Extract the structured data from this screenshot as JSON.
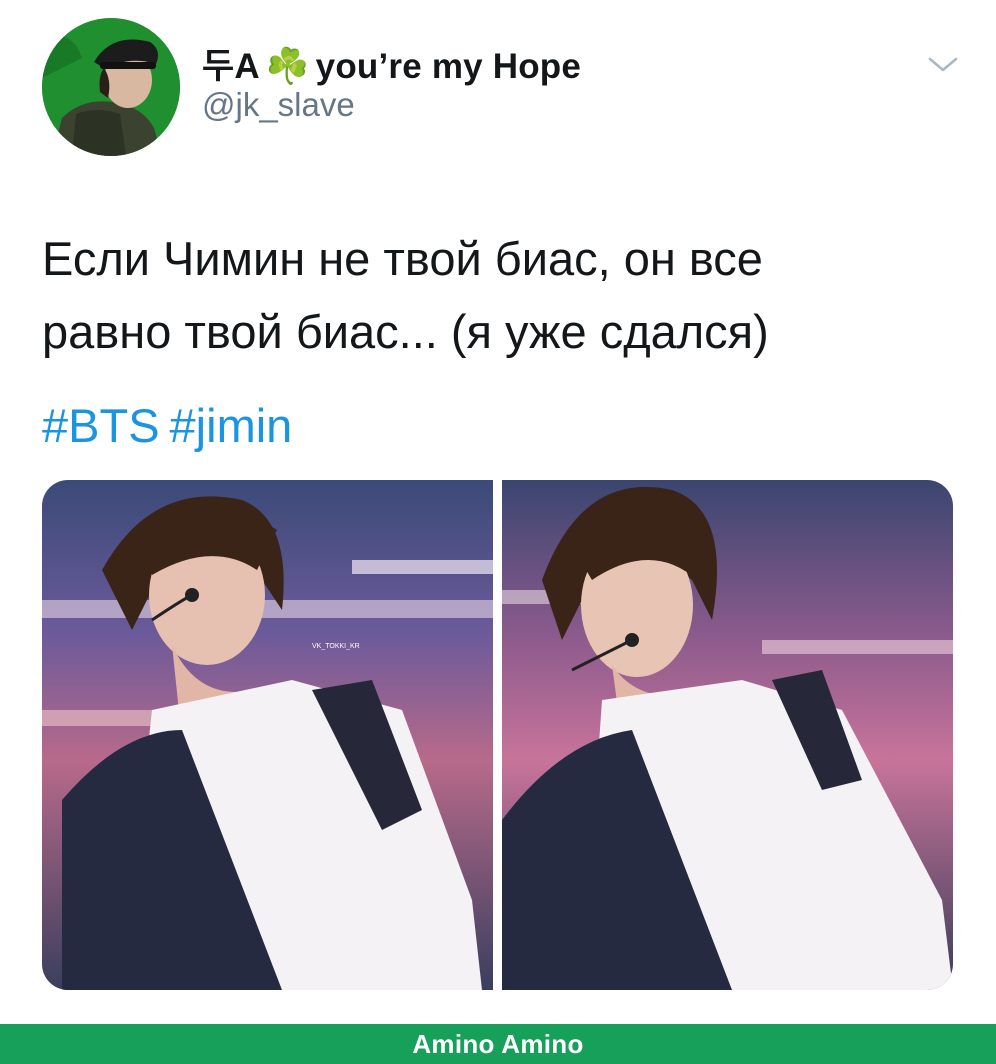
{
  "tweet": {
    "display_name": "두A",
    "display_name_emoji": "☘️",
    "display_name_suffix": "you’re my Hope",
    "handle": "@jk_slave",
    "text_line1": "Если Чимин не твой биас, он все",
    "text_line2": "равно твой биас... (я уже сдался)",
    "hashtags": [
      "#BTS",
      "#jimin"
    ],
    "photos": [
      {
        "watermark": "VK_TOKKI_KR"
      },
      {}
    ],
    "icons": {
      "menu": "chevron-down-icon",
      "avatar": "avatar-photo"
    }
  },
  "footer": {
    "label": "Amino Amino",
    "color": "#16a05a"
  },
  "colors": {
    "hashtag": "#1b95e0",
    "handle": "#657786",
    "text": "#14171a"
  }
}
